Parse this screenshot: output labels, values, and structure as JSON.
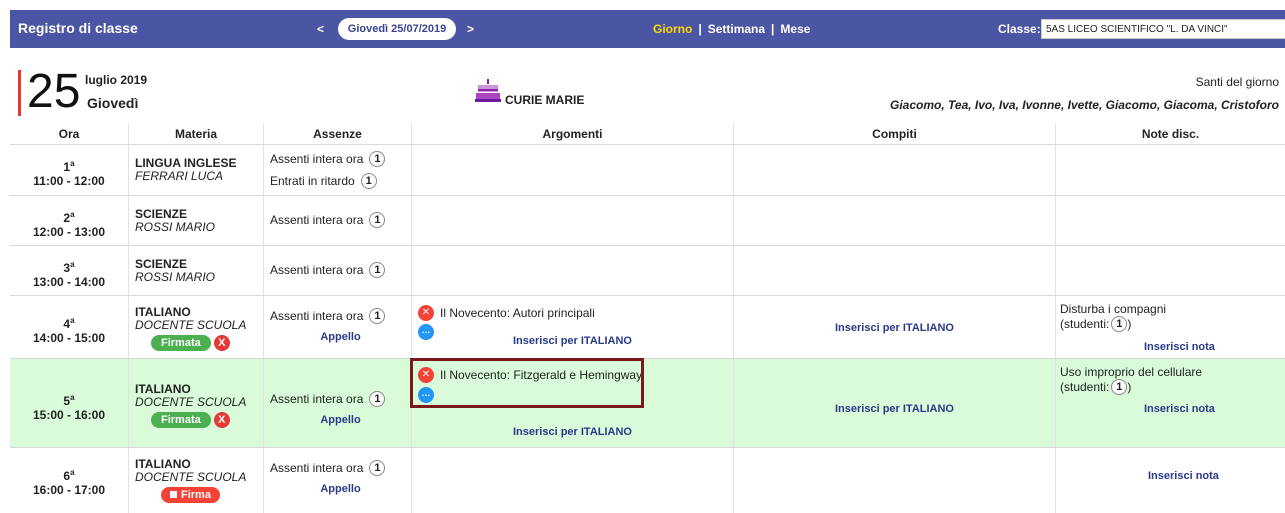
{
  "topbar": {
    "title": "Registro di classe",
    "prev": "<",
    "next": ">",
    "date": "Giovedì 25/07/2019",
    "views": [
      "Giorno",
      "Settimana",
      "Mese"
    ],
    "active_view": "Giorno",
    "classe_label": "Classe:",
    "classe_value": "5AS LICEO SCIENTIFICO \"L. DA VINCI\""
  },
  "day": {
    "number": "25",
    "month_year": "luglio 2019",
    "weekday": "Giovedì",
    "birthday": "CURIE MARIE",
    "santi_title": "Santi del giorno",
    "santi_names": "Giacomo, Tea, Ivo, Iva, Ivonne, Ivette, Giacomo, Giacoma, Cristoforo"
  },
  "headers": [
    "Ora",
    "Materia",
    "Assenze",
    "Argomenti",
    "Compiti",
    "Note disc."
  ],
  "rows": [
    {
      "ora": "1",
      "time": "11:00 - 12:00",
      "subject": "LINGUA INGLESE",
      "teacher": "FERRARI LUCA",
      "assenze": [
        {
          "label": "Assenti intera ora",
          "count": "1"
        },
        {
          "label": "Entrati in ritardo",
          "count": "1"
        }
      ]
    },
    {
      "ora": "2",
      "time": "12:00 - 13:00",
      "subject": "SCIENZE",
      "teacher": "ROSSI MARIO",
      "assenze": [
        {
          "label": "Assenti intera ora",
          "count": "1"
        }
      ]
    },
    {
      "ora": "3",
      "time": "13:00 - 14:00",
      "subject": "SCIENZE",
      "teacher": "ROSSI MARIO",
      "assenze": [
        {
          "label": "Assenti intera ora",
          "count": "1"
        }
      ]
    },
    {
      "ora": "4",
      "time": "14:00 - 15:00",
      "subject": "ITALIANO",
      "teacher": "DOCENTE SCUOLA",
      "sign": "Firmata",
      "sign_remove": "X",
      "assenze": [
        {
          "label": "Assenti intera ora",
          "count": "1"
        }
      ],
      "appello": "Appello",
      "argomento": "Il Novecento: Autori principali",
      "insert_arg": "Inserisci per ITALIANO",
      "insert_compiti": "Inserisci per ITALIANO",
      "note_text": "Disturba i compagni",
      "note_students_prefix": "(studenti:",
      "note_students_count": "1",
      "note_students_suffix": ")",
      "insert_note": "Inserisci nota"
    },
    {
      "ora": "5",
      "time": "15:00 - 16:00",
      "subject": "ITALIANO",
      "teacher": "DOCENTE SCUOLA",
      "sign": "Firmata",
      "sign_remove": "X",
      "assenze": [
        {
          "label": "Assenti intera ora",
          "count": "1"
        }
      ],
      "appello": "Appello",
      "argomento": "Il Novecento: Fitzgerald e Hemingway",
      "insert_arg": "Inserisci per ITALIANO",
      "insert_compiti": "Inserisci per ITALIANO",
      "note_text": "Uso improprio del cellulare",
      "note_students_prefix": "(studenti:",
      "note_students_count": "1",
      "note_students_suffix": ")",
      "insert_note": "Inserisci nota"
    },
    {
      "ora": "6",
      "time": "16:00 - 17:00",
      "subject": "ITALIANO",
      "teacher": "DOCENTE SCUOLA",
      "sign": "Firma",
      "assenze": [
        {
          "label": "Assenti intera ora",
          "count": "1"
        }
      ],
      "appello": "Appello",
      "insert_note": "Inserisci nota"
    }
  ],
  "colors": {
    "topbar": "#4a55a3",
    "active_view": "#ffd800",
    "highlight_row": "#d9fbd9",
    "signed": "#4caf50",
    "delete": "#f44336",
    "more": "#2196f3"
  }
}
